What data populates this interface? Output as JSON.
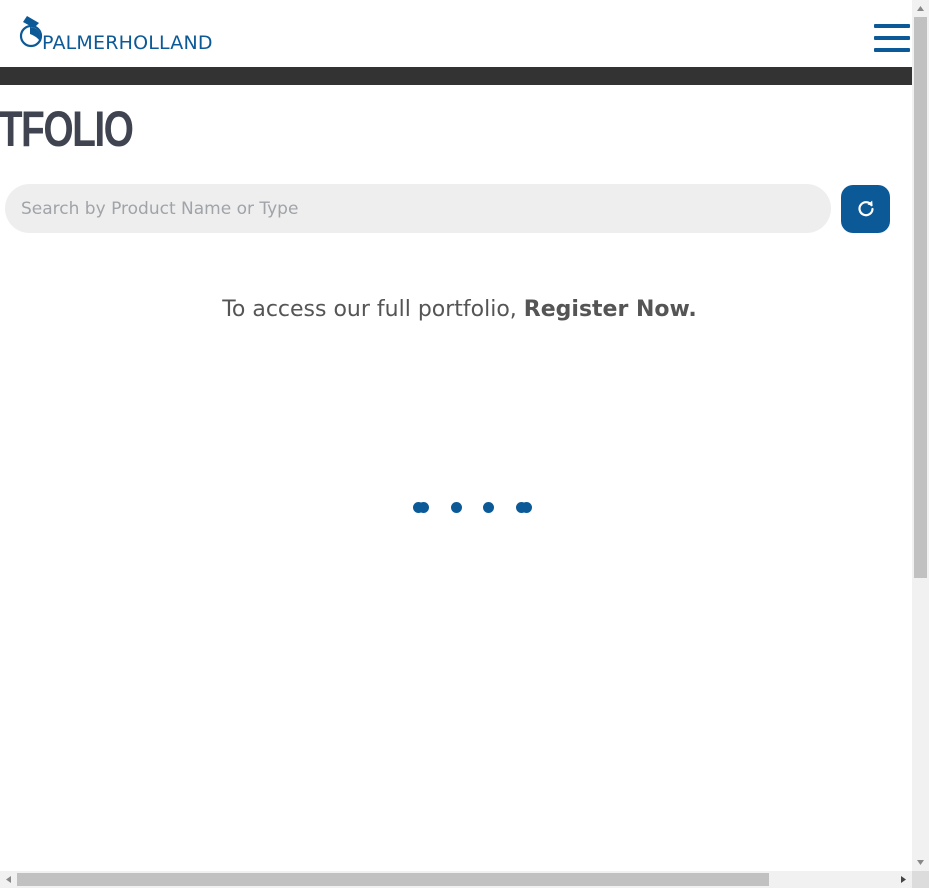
{
  "header": {
    "brand": "PALMERHOLLAND",
    "logo_icon": "palmerholland-logo-icon",
    "menu_icon": "hamburger-menu-icon"
  },
  "page": {
    "title": "RTFOLIO"
  },
  "search": {
    "placeholder": "Search by Product Name or Type",
    "value": "",
    "refresh_icon": "refresh-icon"
  },
  "register": {
    "prefix": "To access our full portfolio, ",
    "link_label": "Register Now."
  },
  "loader": {
    "dots": 4,
    "icon": "loading-dots-icon"
  },
  "colors": {
    "brand_blue": "#0b5a97",
    "dark_bar": "#333333",
    "title_gray": "#3f4450",
    "text_gray": "#555555",
    "search_bg": "#eeeeee"
  }
}
